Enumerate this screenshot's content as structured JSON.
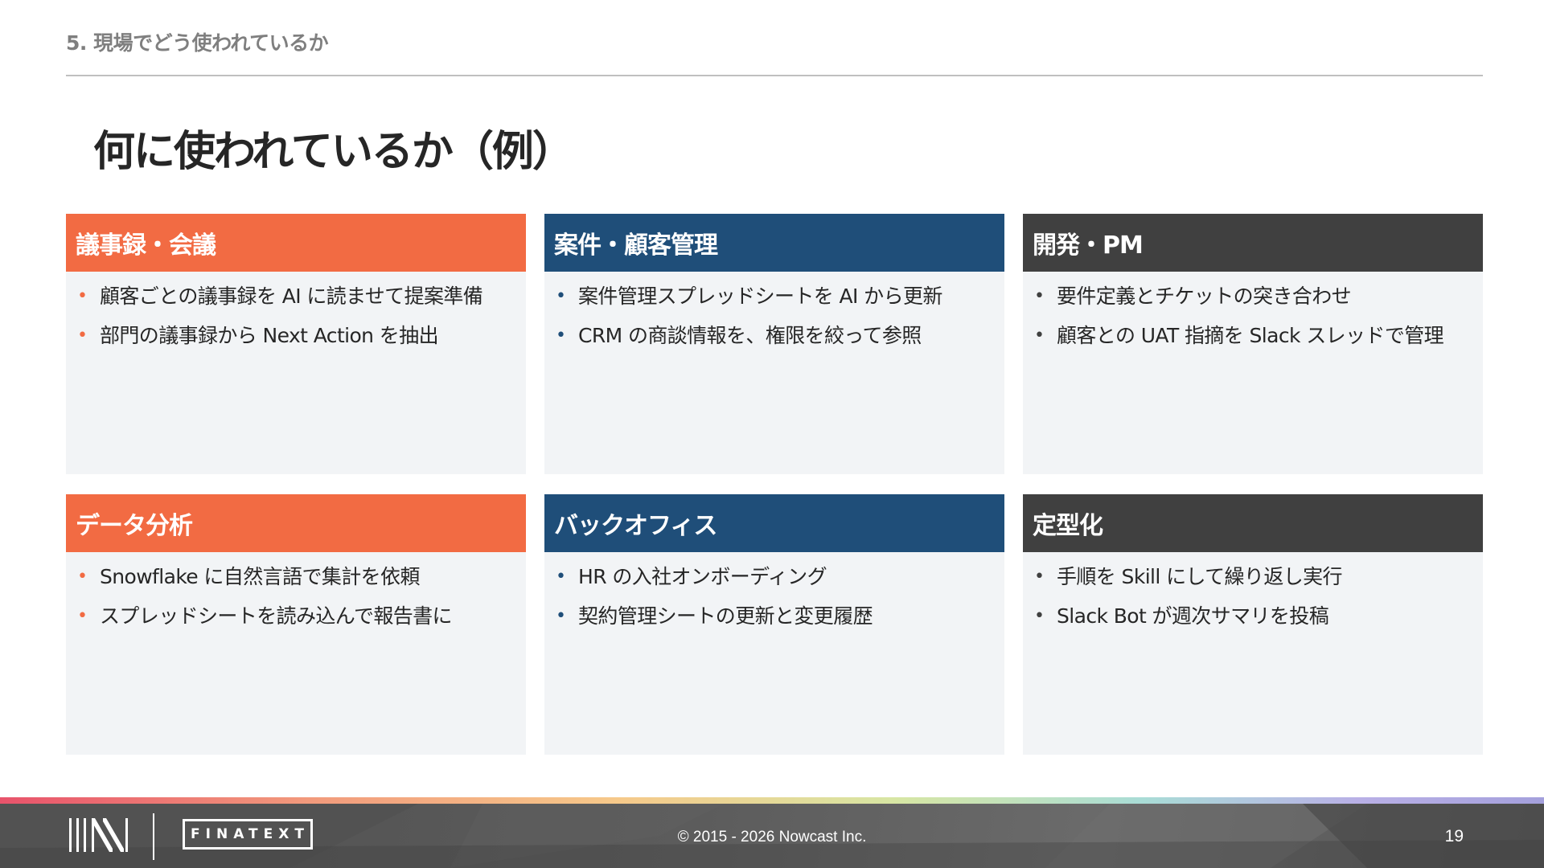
{
  "header": {
    "section_label": "5. 現場でどう使われているか",
    "title": "何に使われているか（例）"
  },
  "colors": {
    "orange": "#f26b43",
    "navy": "#1f4e79",
    "dark": "#404040",
    "card_bg": "#f2f4f6"
  },
  "cards": [
    {
      "title": "議事録・会議",
      "items": [
        "顧客ごとの議事録を AI に読ませて提案準備",
        "部門の議事録から Next Action を抽出"
      ]
    },
    {
      "title": "案件・顧客管理",
      "items": [
        "案件管理スプレッドシートを AI から更新",
        "CRM の商談情報を、権限を絞って参照"
      ]
    },
    {
      "title": "開発・PM",
      "items": [
        "要件定義とチケットの突き合わせ",
        "顧客との UAT 指摘を Slack スレッドで管理"
      ]
    },
    {
      "title": "データ分析",
      "items": [
        "Snowflake に自然言語で集計を依頼",
        "スプレッドシートを読み込んで報告書に"
      ]
    },
    {
      "title": "バックオフィス",
      "items": [
        "HR の入社オンボーディング",
        "契約管理シートの更新と変更履歴"
      ]
    },
    {
      "title": "定型化",
      "items": [
        "手順を Skill にして繰り返し実行",
        "Slack Bot が週次サマリを投稿"
      ]
    }
  ],
  "footer": {
    "brand": "FINATEXT",
    "logo_icon": "nowcast-logo-icon",
    "copyright": "© 2015 - 2026 Nowcast Inc.",
    "page_number": "19"
  }
}
